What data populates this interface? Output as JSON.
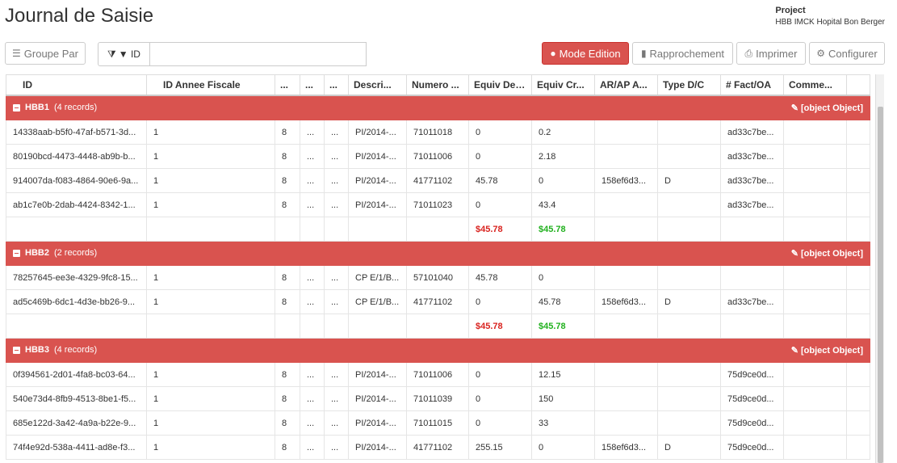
{
  "page": {
    "title": "Journal de Saisie"
  },
  "project": {
    "label": "Project",
    "value": "HBB IMCK Hopital Bon Berger"
  },
  "toolbar": {
    "group_by": "Groupe Par",
    "filter_label": "▼ ID",
    "filter_value": "",
    "mode_edition": "Mode Edition",
    "rapprochement": "Rapprochement",
    "imprimer": "Imprimer",
    "configurer": "Configurer"
  },
  "columns": [
    "ID",
    "ID Annee Fiscale",
    "...",
    "...",
    "...",
    "Descri...",
    "Numero ...",
    "Equiv Debit",
    "Equiv Cr...",
    "AR/AP A...",
    "Type D/C",
    "# Fact/OA",
    "Comme...",
    ""
  ],
  "groups": [
    {
      "name": "HBB1",
      "count": "(4 records)",
      "action": "[object Object]",
      "rows": [
        [
          "14338aab-b5f0-47af-b571-3d...",
          "1",
          "8",
          "...",
          "...",
          "PI/2014-...",
          "71011018",
          "0",
          "0.2",
          "",
          "",
          "ad33c7be...",
          ""
        ],
        [
          "80190bcd-4473-4448-ab9b-b...",
          "1",
          "8",
          "...",
          "...",
          "PI/2014-...",
          "71011006",
          "0",
          "2.18",
          "",
          "",
          "ad33c7be...",
          ""
        ],
        [
          "914007da-f083-4864-90e6-9a...",
          "1",
          "8",
          "...",
          "...",
          "PI/2014-...",
          "41771102",
          "45.78",
          "0",
          "158ef6d3...",
          "D",
          "ad33c7be...",
          ""
        ],
        [
          "ab1c7e0b-2dab-4424-8342-1...",
          "1",
          "8",
          "...",
          "...",
          "PI/2014-...",
          "71011023",
          "0",
          "43.4",
          "",
          "",
          "ad33c7be...",
          ""
        ]
      ],
      "total_debit": "$45.78",
      "total_credit": "$45.78"
    },
    {
      "name": "HBB2",
      "count": "(2 records)",
      "action": "[object Object]",
      "rows": [
        [
          "78257645-ee3e-4329-9fc8-15...",
          "1",
          "8",
          "...",
          "...",
          "CP E/1/B...",
          "57101040",
          "45.78",
          "0",
          "",
          "",
          "",
          ""
        ],
        [
          "ad5c469b-6dc1-4d3e-bb26-9...",
          "1",
          "8",
          "...",
          "...",
          "CP E/1/B...",
          "41771102",
          "0",
          "45.78",
          "158ef6d3...",
          "D",
          "ad33c7be...",
          ""
        ]
      ],
      "total_debit": "$45.78",
      "total_credit": "$45.78"
    },
    {
      "name": "HBB3",
      "count": "(4 records)",
      "action": "[object Object]",
      "rows": [
        [
          "0f394561-2d01-4fa8-bc03-64...",
          "1",
          "8",
          "...",
          "...",
          "PI/2014-...",
          "71011006",
          "0",
          "12.15",
          "",
          "",
          "75d9ce0d...",
          ""
        ],
        [
          "540e73d4-8fb9-4513-8be1-f5...",
          "1",
          "8",
          "...",
          "...",
          "PI/2014-...",
          "71011039",
          "0",
          "150",
          "",
          "",
          "75d9ce0d...",
          ""
        ],
        [
          "685e122d-3a42-4a9a-b22e-9...",
          "1",
          "8",
          "...",
          "...",
          "PI/2014-...",
          "71011015",
          "0",
          "33",
          "",
          "",
          "75d9ce0d...",
          ""
        ],
        [
          "74f4e92d-538a-4411-ad8e-f3...",
          "1",
          "8",
          "...",
          "...",
          "PI/2014-...",
          "41771102",
          "255.15",
          "0",
          "158ef6d3...",
          "D",
          "75d9ce0d...",
          ""
        ]
      ]
    }
  ],
  "colors": {
    "group_header": "#d9534f",
    "debit_total": "#d9231f",
    "credit_total": "#22b11f"
  }
}
